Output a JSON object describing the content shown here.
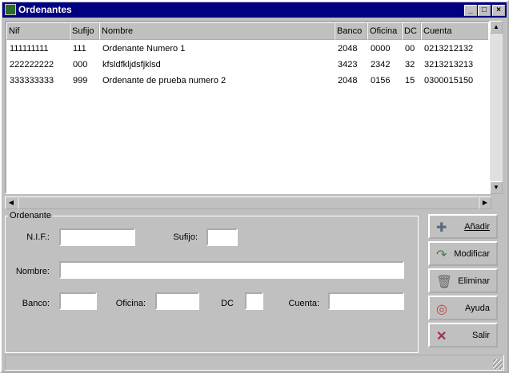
{
  "window": {
    "title": "Ordenantes"
  },
  "table": {
    "columns": [
      "Nif",
      "Sufijo",
      "Nombre",
      "Banco",
      "Oficina",
      "DC",
      "Cuenta"
    ],
    "rows": [
      [
        "111111111",
        "111",
        "Ordenante Numero 1",
        "2048",
        "0000",
        "00",
        "0213212132"
      ],
      [
        "222222222",
        "000",
        "kfsldfkljdsfjklsd",
        "3423",
        "2342",
        "32",
        "3213213213"
      ],
      [
        "333333333",
        "999",
        "Ordenante de prueba numero 2",
        "2048",
        "0156",
        "15",
        "0300015150"
      ]
    ]
  },
  "form": {
    "group": "Ordenante",
    "nif": "N.I.F.:",
    "sufijo": "Sufijo:",
    "nombre": "Nombre:",
    "banco": "Banco:",
    "oficina": "Oficina:",
    "dc": "DC",
    "cuenta": "Cuenta:"
  },
  "buttons": {
    "add": "Añadir",
    "modify": "Modificar",
    "delete": "Eliminar",
    "help": "Ayuda",
    "exit": "Salir"
  }
}
